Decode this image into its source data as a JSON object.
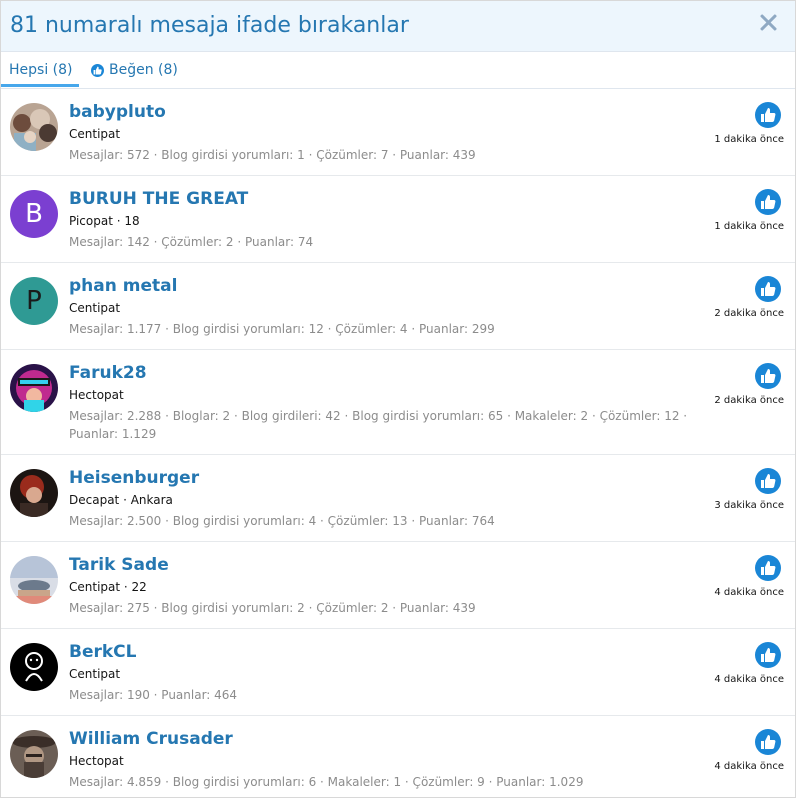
{
  "dialog": {
    "title": "81 numaralı mesaja ifade bırakanlar"
  },
  "tabs": {
    "all_label": "Hepsi (8)",
    "like_label": "Beğen (8)"
  },
  "colors": {
    "accent": "#2577b1",
    "like_blue": "#1a86d6",
    "header_bg": "#edf6fd"
  },
  "rows": [
    {
      "name": "babypluto",
      "title": "Centipat",
      "stats": "Mesajlar: 572 · Blog girdisi yorumları: 1 · Çözümler: 7 · Puanlar: 439",
      "time": "1 dakika önce",
      "avatar": "photo"
    },
    {
      "name": "BURUH THE GREAT",
      "title": "Picopat · 18",
      "stats": "Mesajlar: 142 · Çözümler: 2 · Puanlar: 74",
      "time": "1 dakika önce",
      "avatar": "letter",
      "letter": "B",
      "avatar_color": "#7b3fd1"
    },
    {
      "name": "phan metal",
      "title": "Centipat",
      "stats": "Mesajlar: 1.177 · Blog girdisi yorumları: 12 · Çözümler: 4 · Puanlar: 299",
      "time": "2 dakika önce",
      "avatar": "letter",
      "letter": "P",
      "avatar_color": "#2f9a94"
    },
    {
      "name": "Faruk28",
      "title": "Hectopat",
      "stats": "Mesajlar: 2.288 · Bloglar: 2 · Blog girdileri: 42 · Blog girdisi yorumları: 65 · Makaleler: 2 · Çözümler: 12 · Puanlar: 1.129",
      "time": "2 dakika önce",
      "avatar": "photo"
    },
    {
      "name": "Heisenburger",
      "title": "Decapat · Ankara",
      "stats": "Mesajlar: 2.500 · Blog girdisi yorumları: 4 · Çözümler: 13 · Puanlar: 764",
      "time": "3 dakika önce",
      "avatar": "photo"
    },
    {
      "name": "Tarik Sade",
      "title": "Centipat · 22",
      "stats": "Mesajlar: 275 · Blog girdisi yorumları: 2 · Çözümler: 2 · Puanlar: 439",
      "time": "4 dakika önce",
      "avatar": "photo"
    },
    {
      "name": "BerkCL",
      "title": "Centipat",
      "stats": "Mesajlar: 190 · Puanlar: 464",
      "time": "4 dakika önce",
      "avatar": "photo"
    },
    {
      "name": "William Crusader",
      "title": "Hectopat",
      "stats": "Mesajlar: 4.859 · Blog girdisi yorumları: 6 · Makaleler: 1 · Çözümler: 9 · Puanlar: 1.029",
      "time": "4 dakika önce",
      "avatar": "photo"
    }
  ]
}
